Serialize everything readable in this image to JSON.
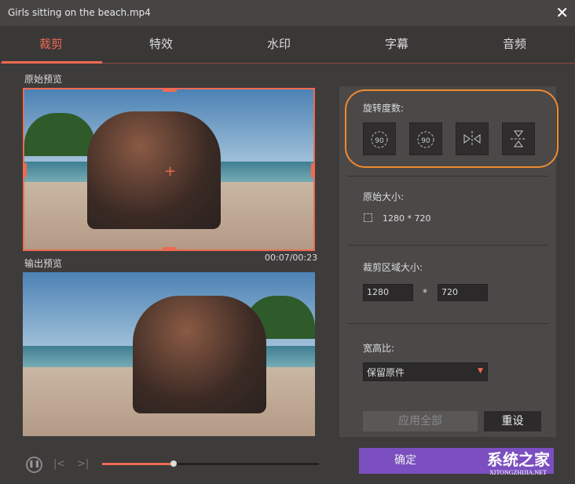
{
  "window": {
    "title": "Girls sitting on the beach.mp4",
    "close": "✕"
  },
  "tabs": [
    {
      "label": "裁剪"
    },
    {
      "label": "特效"
    },
    {
      "label": "水印"
    },
    {
      "label": "字幕"
    },
    {
      "label": "音频"
    }
  ],
  "preview": {
    "original_label": "原始预览",
    "output_label": "输出预览",
    "timecode": "00:07/00:23",
    "progress": 0.33
  },
  "panel": {
    "rotation_label": "旋转度数:",
    "rotate_value": "90",
    "original_size_label": "原始大小:",
    "original_size": "1280 * 720",
    "crop_size_label": "裁剪区域大小:",
    "crop_width": "1280",
    "crop_sep": "*",
    "crop_height": "720",
    "aspect_label": "宽高比:",
    "aspect_value": "保留原件",
    "apply_all": "应用全部",
    "reset": "重设"
  },
  "footer": {
    "confirm": "确定"
  },
  "watermark": {
    "name": "系统之家",
    "url": "XITONGZHIJIA.NET"
  },
  "colors": {
    "accent": "#ee6a52",
    "highlight": "#f08a30",
    "confirm": "#7b4fc0"
  }
}
